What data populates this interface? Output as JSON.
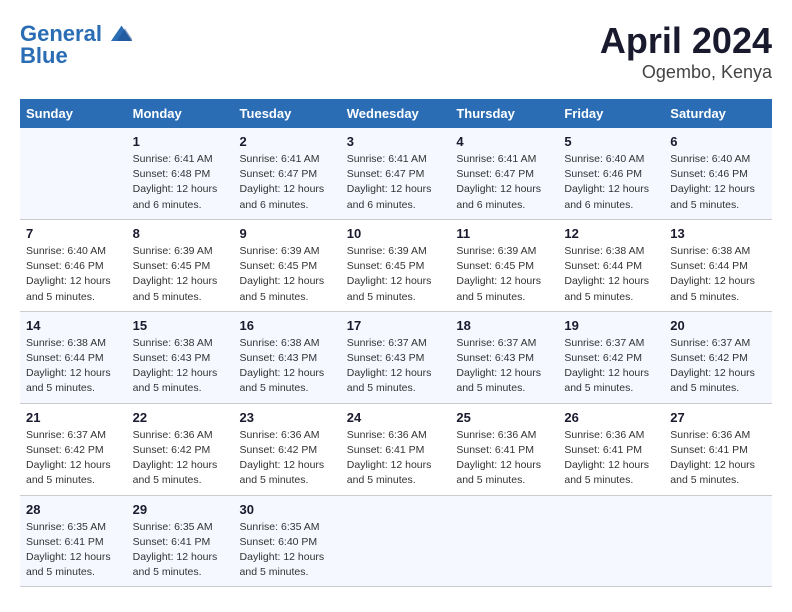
{
  "header": {
    "logo_line1": "General",
    "logo_line2": "Blue",
    "month": "April 2024",
    "location": "Ogembo, Kenya"
  },
  "columns": [
    "Sunday",
    "Monday",
    "Tuesday",
    "Wednesday",
    "Thursday",
    "Friday",
    "Saturday"
  ],
  "weeks": [
    [
      {
        "day": "",
        "info": ""
      },
      {
        "day": "1",
        "info": "Sunrise: 6:41 AM\nSunset: 6:48 PM\nDaylight: 12 hours\nand 6 minutes."
      },
      {
        "day": "2",
        "info": "Sunrise: 6:41 AM\nSunset: 6:47 PM\nDaylight: 12 hours\nand 6 minutes."
      },
      {
        "day": "3",
        "info": "Sunrise: 6:41 AM\nSunset: 6:47 PM\nDaylight: 12 hours\nand 6 minutes."
      },
      {
        "day": "4",
        "info": "Sunrise: 6:41 AM\nSunset: 6:47 PM\nDaylight: 12 hours\nand 6 minutes."
      },
      {
        "day": "5",
        "info": "Sunrise: 6:40 AM\nSunset: 6:46 PM\nDaylight: 12 hours\nand 6 minutes."
      },
      {
        "day": "6",
        "info": "Sunrise: 6:40 AM\nSunset: 6:46 PM\nDaylight: 12 hours\nand 5 minutes."
      }
    ],
    [
      {
        "day": "7",
        "info": "Sunrise: 6:40 AM\nSunset: 6:46 PM\nDaylight: 12 hours\nand 5 minutes."
      },
      {
        "day": "8",
        "info": "Sunrise: 6:39 AM\nSunset: 6:45 PM\nDaylight: 12 hours\nand 5 minutes."
      },
      {
        "day": "9",
        "info": "Sunrise: 6:39 AM\nSunset: 6:45 PM\nDaylight: 12 hours\nand 5 minutes."
      },
      {
        "day": "10",
        "info": "Sunrise: 6:39 AM\nSunset: 6:45 PM\nDaylight: 12 hours\nand 5 minutes."
      },
      {
        "day": "11",
        "info": "Sunrise: 6:39 AM\nSunset: 6:45 PM\nDaylight: 12 hours\nand 5 minutes."
      },
      {
        "day": "12",
        "info": "Sunrise: 6:38 AM\nSunset: 6:44 PM\nDaylight: 12 hours\nand 5 minutes."
      },
      {
        "day": "13",
        "info": "Sunrise: 6:38 AM\nSunset: 6:44 PM\nDaylight: 12 hours\nand 5 minutes."
      }
    ],
    [
      {
        "day": "14",
        "info": "Sunrise: 6:38 AM\nSunset: 6:44 PM\nDaylight: 12 hours\nand 5 minutes."
      },
      {
        "day": "15",
        "info": "Sunrise: 6:38 AM\nSunset: 6:43 PM\nDaylight: 12 hours\nand 5 minutes."
      },
      {
        "day": "16",
        "info": "Sunrise: 6:38 AM\nSunset: 6:43 PM\nDaylight: 12 hours\nand 5 minutes."
      },
      {
        "day": "17",
        "info": "Sunrise: 6:37 AM\nSunset: 6:43 PM\nDaylight: 12 hours\nand 5 minutes."
      },
      {
        "day": "18",
        "info": "Sunrise: 6:37 AM\nSunset: 6:43 PM\nDaylight: 12 hours\nand 5 minutes."
      },
      {
        "day": "19",
        "info": "Sunrise: 6:37 AM\nSunset: 6:42 PM\nDaylight: 12 hours\nand 5 minutes."
      },
      {
        "day": "20",
        "info": "Sunrise: 6:37 AM\nSunset: 6:42 PM\nDaylight: 12 hours\nand 5 minutes."
      }
    ],
    [
      {
        "day": "21",
        "info": "Sunrise: 6:37 AM\nSunset: 6:42 PM\nDaylight: 12 hours\nand 5 minutes."
      },
      {
        "day": "22",
        "info": "Sunrise: 6:36 AM\nSunset: 6:42 PM\nDaylight: 12 hours\nand 5 minutes."
      },
      {
        "day": "23",
        "info": "Sunrise: 6:36 AM\nSunset: 6:42 PM\nDaylight: 12 hours\nand 5 minutes."
      },
      {
        "day": "24",
        "info": "Sunrise: 6:36 AM\nSunset: 6:41 PM\nDaylight: 12 hours\nand 5 minutes."
      },
      {
        "day": "25",
        "info": "Sunrise: 6:36 AM\nSunset: 6:41 PM\nDaylight: 12 hours\nand 5 minutes."
      },
      {
        "day": "26",
        "info": "Sunrise: 6:36 AM\nSunset: 6:41 PM\nDaylight: 12 hours\nand 5 minutes."
      },
      {
        "day": "27",
        "info": "Sunrise: 6:36 AM\nSunset: 6:41 PM\nDaylight: 12 hours\nand 5 minutes."
      }
    ],
    [
      {
        "day": "28",
        "info": "Sunrise: 6:35 AM\nSunset: 6:41 PM\nDaylight: 12 hours\nand 5 minutes."
      },
      {
        "day": "29",
        "info": "Sunrise: 6:35 AM\nSunset: 6:41 PM\nDaylight: 12 hours\nand 5 minutes."
      },
      {
        "day": "30",
        "info": "Sunrise: 6:35 AM\nSunset: 6:40 PM\nDaylight: 12 hours\nand 5 minutes."
      },
      {
        "day": "",
        "info": ""
      },
      {
        "day": "",
        "info": ""
      },
      {
        "day": "",
        "info": ""
      },
      {
        "day": "",
        "info": ""
      }
    ]
  ]
}
